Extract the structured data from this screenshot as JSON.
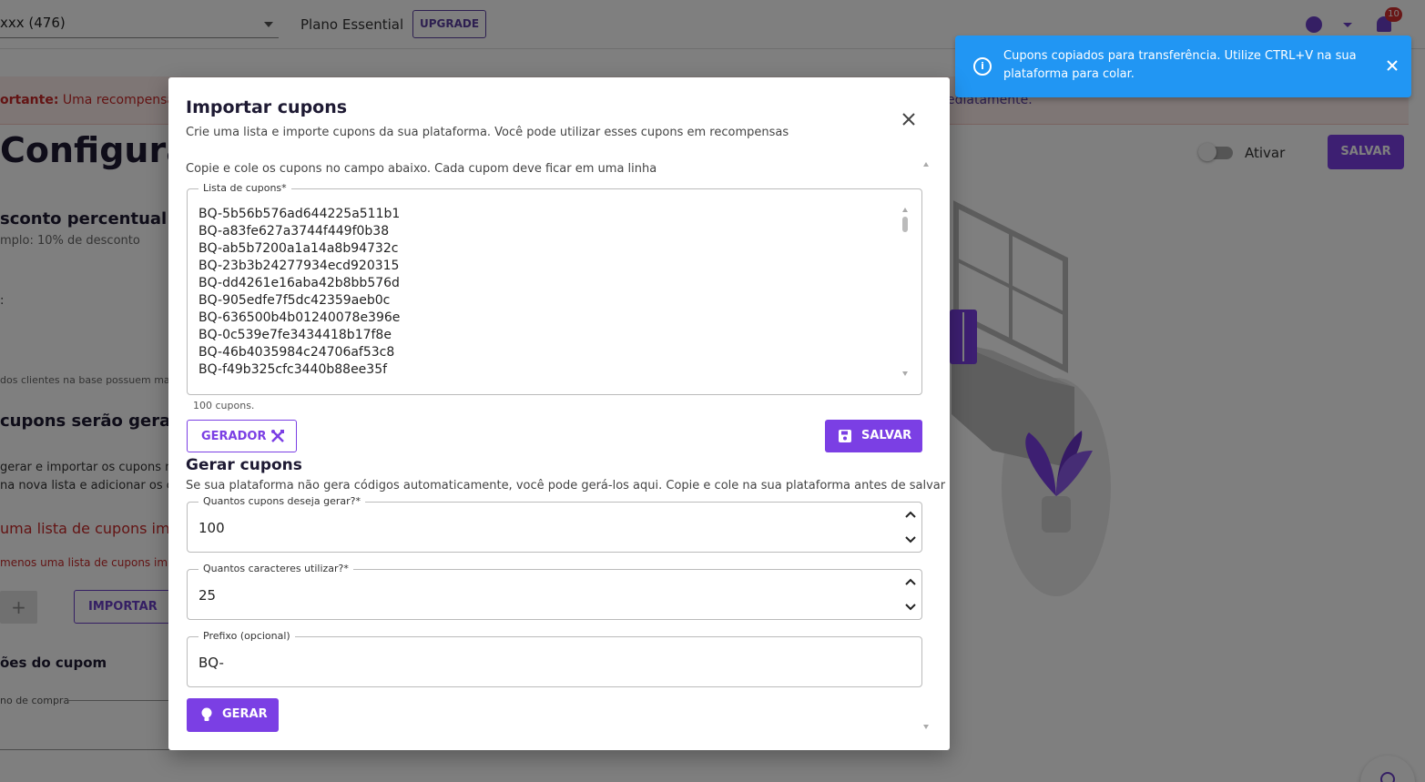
{
  "header": {
    "store_select_value": "xxx (476)",
    "plan_label": "Plano Essential",
    "upgrade_label": "UPGRADE",
    "notification_count": "10"
  },
  "banner": {
    "prefix": "ortante:",
    "text": " Uma recompensa est",
    "link_tail": "ediatamente."
  },
  "page": {
    "title": "Configurar",
    "toggle_label": "Ativar",
    "save_label": "SALVAR",
    "discount_title": "sconto percentual",
    "discount_example": "mplo: 10% de desconto",
    "colon_label": ":",
    "clients_note": "dos clientes na base possuem ma",
    "coupons_heading": "cupons serão gerad",
    "gen_text_line1": "gerar e importar os cupons m",
    "gen_text_line2": "na nova lista e adicionar os cu",
    "import_list_error": "uma lista de cupons impo",
    "min_list_error": "menos uma lista de cupons impo",
    "add_label": "+",
    "import_label": "IMPORTAR",
    "coupon_options_heading": "ões do cupom",
    "purchase_field_label": "no de compra"
  },
  "toast": {
    "message": "Cupons copiados para transferência. Utilize CTRL+V na sua plataforma para colar.",
    "info_glyph": "i"
  },
  "modal": {
    "title": "Importar cupons",
    "subtitle": "Crie uma lista e importe cupons da sua plataforma. Você pode utilizar esses cupons em recompensas",
    "instruction": "Copie e cole os cupons no campo abaixo. Cada cupom deve ficar em uma linha",
    "list_label": "Lista de cupons*",
    "coupons": [
      "BQ-5b56b576ad644225a511b1",
      "BQ-a83fe627a3744f449f0b38",
      "BQ-ab5b7200a1a14a8b94732c",
      "BQ-23b3b24277934ecd920315",
      "BQ-dd4261e16aba42b8bb576d",
      "BQ-905edfe7f5dc42359aeb0c",
      "BQ-636500b4b01240078e396e",
      "BQ-0c539e7fe3434418b17f8e",
      "BQ-46b4035984c24706af53c8",
      "BQ-f49b325cfc3440b88ee35f"
    ],
    "coupon_count": "100 cupons.",
    "generator_label": "GERADOR",
    "save_label": "SALVAR",
    "generate_heading": "Gerar cupons",
    "generate_desc": "Se sua plataforma não gera códigos automaticamente, você pode gerá-los aqui. Copie e cole na sua plataforma antes de salvar",
    "qty_label": "Quantos cupons deseja gerar?*",
    "qty_value": "100",
    "chars_label": "Quantos caracteres utilizar?*",
    "chars_value": "25",
    "prefix_label": "Prefixo (opcional)",
    "prefix_value": "BQ-",
    "generate_label": "GERAR"
  },
  "colors": {
    "primary": "#7b3fe4",
    "toast": "#2196f3",
    "error": "#c62828",
    "dark_text": "#1e1a33"
  }
}
